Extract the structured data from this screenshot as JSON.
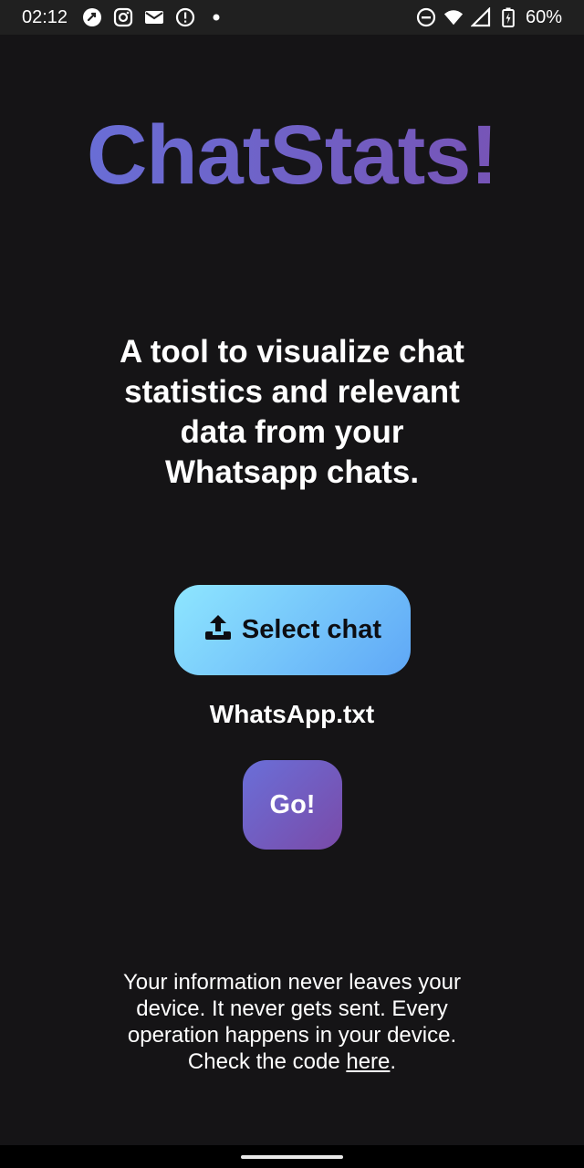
{
  "status_bar": {
    "time": "02:12",
    "battery": "60%",
    "left_icons": [
      "sync-icon",
      "instagram-icon",
      "mail-icon",
      "alert-icon",
      "dot-icon"
    ],
    "right_icons": [
      "do-not-disturb-icon",
      "wifi-icon",
      "signal-icon",
      "battery-charging-icon"
    ]
  },
  "app": {
    "title": "ChatStats!",
    "tagline": "A tool to visualize chat statistics and relevant data from your Whatsapp chats.",
    "select_button_label": "Select chat",
    "selected_file": "WhatsApp.txt",
    "go_button_label": "Go!",
    "footer_text": "Your information never leaves your device. It never gets sent. Every operation happens in your device. Check the code ",
    "footer_link": "here",
    "footer_end": "."
  },
  "colors": {
    "background": "#151416",
    "title_gradient_start": "#6673dc",
    "title_gradient_end": "#7a4fb0",
    "select_button_start": "#8ee6ff",
    "select_button_end": "#5fa7f6",
    "go_button_start": "#6a6fd8",
    "go_button_end": "#7a4aa8"
  }
}
